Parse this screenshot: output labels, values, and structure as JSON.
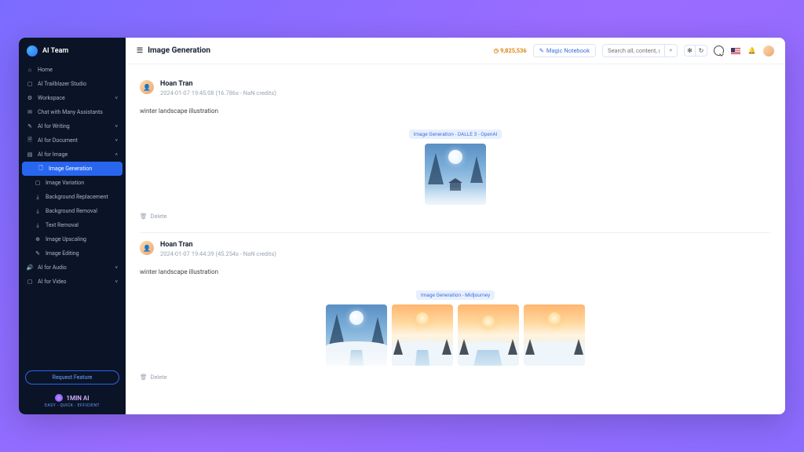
{
  "sidebar": {
    "team_name": "AI Team",
    "items": [
      {
        "label": "Home",
        "icon": "⌂"
      },
      {
        "label": "AI Trailblazer Studio",
        "icon": "▢"
      },
      {
        "label": "Workspace",
        "icon": "⚙",
        "expandable": true
      },
      {
        "label": "Chat with Many Assistants",
        "icon": "✉"
      },
      {
        "label": "AI for Writing",
        "icon": "✎",
        "expandable": true
      },
      {
        "label": "AI for Document",
        "icon": "🗎",
        "expandable": true
      },
      {
        "label": "AI for Image",
        "icon": "▤",
        "expandable": true,
        "expanded": true
      },
      {
        "label": "Image Generation",
        "sub": true,
        "active": true,
        "icon": "🗋"
      },
      {
        "label": "Image Variation",
        "sub": true,
        "icon": "▢"
      },
      {
        "label": "Background Replacement",
        "sub": true,
        "icon": "⤓"
      },
      {
        "label": "Background Removal",
        "sub": true,
        "icon": "⤓"
      },
      {
        "label": "Text Removal",
        "sub": true,
        "icon": "⤓"
      },
      {
        "label": "Image Upscaling",
        "sub": true,
        "icon": "⊕"
      },
      {
        "label": "Image Editing",
        "sub": true,
        "icon": "✎"
      },
      {
        "label": "AI for Audio",
        "icon": "🔊",
        "expandable": true
      },
      {
        "label": "AI for Video",
        "icon": "▢",
        "expandable": true
      }
    ],
    "request_feature": "Request Feature",
    "footer_brand": "1MIN AI",
    "footer_tagline": "EASY - QUICK - EFFICIENT"
  },
  "header": {
    "title": "Image Generation",
    "credits": "9,825,536",
    "magic_notebook": "Magic Notebook",
    "search_placeholder": "Search all, content, g..."
  },
  "entries": [
    {
      "user": "Hoan Tran",
      "timestamp": "2024-01-07 19:45:08 (16.786s - NaN credits)",
      "prompt": "winter landscape illustration",
      "badge": "Image Generation - DALLE 3 - OpenAI",
      "image_count": 1,
      "delete_label": "Delete"
    },
    {
      "user": "Hoan Tran",
      "timestamp": "2024-01-07 19:44:39 (45.254s - NaN credits)",
      "prompt": "winter landscape illustration",
      "badge": "Image Generation - Midjourney",
      "image_count": 4,
      "delete_label": "Delete"
    }
  ]
}
